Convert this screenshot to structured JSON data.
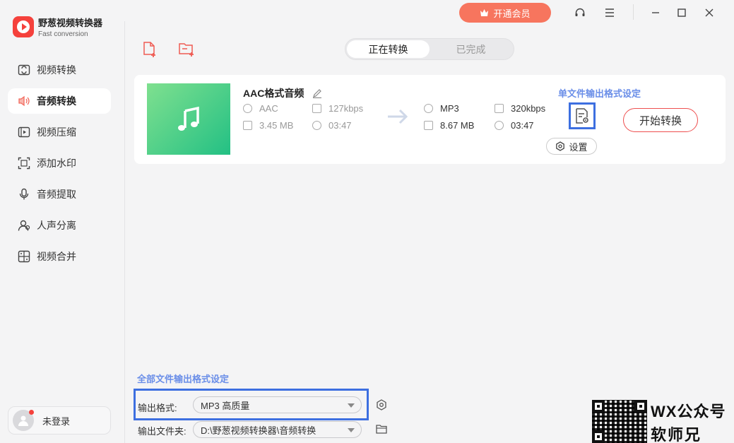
{
  "app": {
    "name": "野葱视频转换器",
    "subtitle": "Fast conversion"
  },
  "sidebar": {
    "items": [
      {
        "label": "视频转换",
        "icon": "video-convert-icon",
        "active": false
      },
      {
        "label": "音频转换",
        "icon": "audio-convert-icon",
        "active": true
      },
      {
        "label": "视频压缩",
        "icon": "video-compress-icon",
        "active": false
      },
      {
        "label": "添加水印",
        "icon": "watermark-icon",
        "active": false
      },
      {
        "label": "音频提取",
        "icon": "audio-extract-icon",
        "active": false
      },
      {
        "label": "人声分离",
        "icon": "vocal-separate-icon",
        "active": false
      },
      {
        "label": "视频合并",
        "icon": "video-merge-icon",
        "active": false
      }
    ],
    "user": {
      "name": "未登录"
    }
  },
  "titlebar": {
    "vip_label": "开通会员",
    "icons": [
      "headset-icon",
      "menu-icon",
      "minimize-icon",
      "maximize-icon",
      "close-icon"
    ]
  },
  "tabs": [
    {
      "label": "正在转换",
      "active": true
    },
    {
      "label": "已完成",
      "active": false
    }
  ],
  "task": {
    "title": "AAC格式音频",
    "source": {
      "format": "AAC",
      "bitrate": "127kbps",
      "size": "3.45 MB",
      "duration": "03:47"
    },
    "target": {
      "format": "MP3",
      "bitrate": "320kbps",
      "size": "8.67 MB",
      "duration": "03:47"
    },
    "single_setting_title": "单文件输出格式设定",
    "settings_label": "设置",
    "start_label": "开始转换"
  },
  "bottom": {
    "all_setting_title": "全部文件输出格式设定",
    "format_label": "输出格式:",
    "format_value": "MP3 高质量",
    "folder_label": "输出文件夹:",
    "folder_value": "D:\\野葱视频转换器\\音频转换"
  },
  "watermark": {
    "line1": "WX公众号",
    "line2": "软师兄"
  },
  "colors": {
    "accent": "#f7755e",
    "start_border": "#ee4f4f",
    "highlight": "#3d6fe0",
    "link_blue": "#6a8ee8",
    "thumb_green": "#23c084"
  }
}
